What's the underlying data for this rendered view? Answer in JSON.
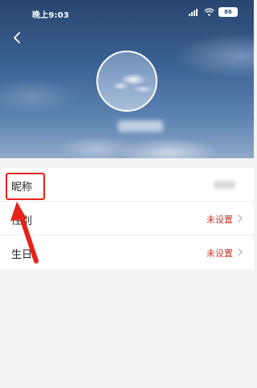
{
  "status_bar": {
    "time": "晚上9:03",
    "battery": "86"
  },
  "profile_list": [
    {
      "label": "昵称",
      "value": ""
    },
    {
      "label": "性别",
      "value": "未设置"
    },
    {
      "label": "生日",
      "value": "未设置"
    }
  ],
  "colors": {
    "accent": "#c0392b",
    "highlight": "#e5231a"
  },
  "icons": {
    "back": "chevron-left-icon",
    "row_arrow": "chevron-right-icon"
  }
}
